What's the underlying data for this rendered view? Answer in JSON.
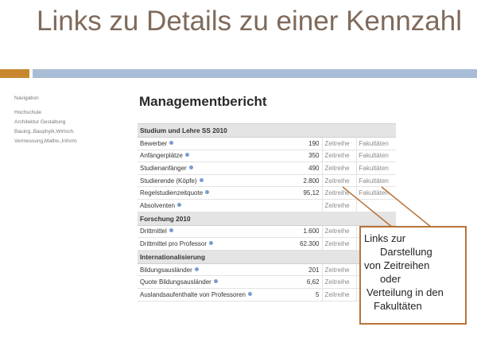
{
  "slide": {
    "title": "Links zu Details zu einer Kennzahl"
  },
  "sidebar": {
    "heading": "Navigation",
    "items": [
      "Hochschule",
      "Architektur Gestaltung",
      "Bauing.,Bauphyik,Wirtsch.",
      "Vermessung,Mathe.,Inform."
    ]
  },
  "report": {
    "title": "Managementbericht",
    "link_zeitreihe": "Zeitreihe",
    "link_fakultaeten": "Fakultäten",
    "sections": [
      {
        "heading": "Studium und Lehre SS 2010",
        "rows": [
          {
            "label": "Bewerber",
            "value": "190",
            "zeitreihe": "Zeitreihe",
            "fakultaeten": "Fakultäten"
          },
          {
            "label": "Anfängerplätze",
            "value": "350",
            "zeitreihe": "Zeitreihe",
            "fakultaeten": "Fakultäten"
          },
          {
            "label": "Studienanfänger",
            "value": "490",
            "zeitreihe": "Zeitreihe",
            "fakultaeten": "Fakultäten"
          },
          {
            "label": "Studierende (Köpfe)",
            "value": "2.800",
            "zeitreihe": "Zeitreihe",
            "fakultaeten": "Fakultäten"
          },
          {
            "label": "Regelstudienzeitquote",
            "value": "95,12",
            "zeitreihe": "Zeitreihe",
            "fakultaeten": "Fakultäten"
          },
          {
            "label": "Absolventen",
            "value": "",
            "zeitreihe": "Zeitreihe",
            "fakultaeten": ""
          }
        ]
      },
      {
        "heading": "Forschung 2010",
        "rows": [
          {
            "label": "Drittmittel",
            "value": "1.600",
            "zeitreihe": "Zeitreihe",
            "fakultaeten": ""
          },
          {
            "label": "Drittmittel pro Professor",
            "value": "62.300",
            "zeitreihe": "Zeitreihe",
            "fakultaeten": ""
          }
        ]
      },
      {
        "heading": "Internationalisierung",
        "rows": [
          {
            "label": "Bildungsausländer",
            "value": "201",
            "zeitreihe": "Zeitreihe",
            "fakultaeten": ""
          },
          {
            "label": "Quote Bildungsausländer",
            "value": "6,62",
            "zeitreihe": "Zeitreihe",
            "fakultaeten": ""
          },
          {
            "label": "Auslandsaufenthalte von Professoren",
            "value": "5",
            "zeitreihe": "Zeitreihe",
            "fakultaeten": ""
          }
        ]
      }
    ]
  },
  "callout": {
    "lines": [
      "Links zur",
      "Darstellung",
      "von Zeitreihen",
      "oder",
      "Verteilung in den",
      "Fakultäten"
    ]
  },
  "colors": {
    "title": "#7f6a5b",
    "band_orange": "#c8872f",
    "band_blue": "#a9bdd6",
    "callout_border": "#b8733a",
    "info_dot": "#7a9cd0"
  },
  "icons": {
    "info": "info-icon"
  }
}
